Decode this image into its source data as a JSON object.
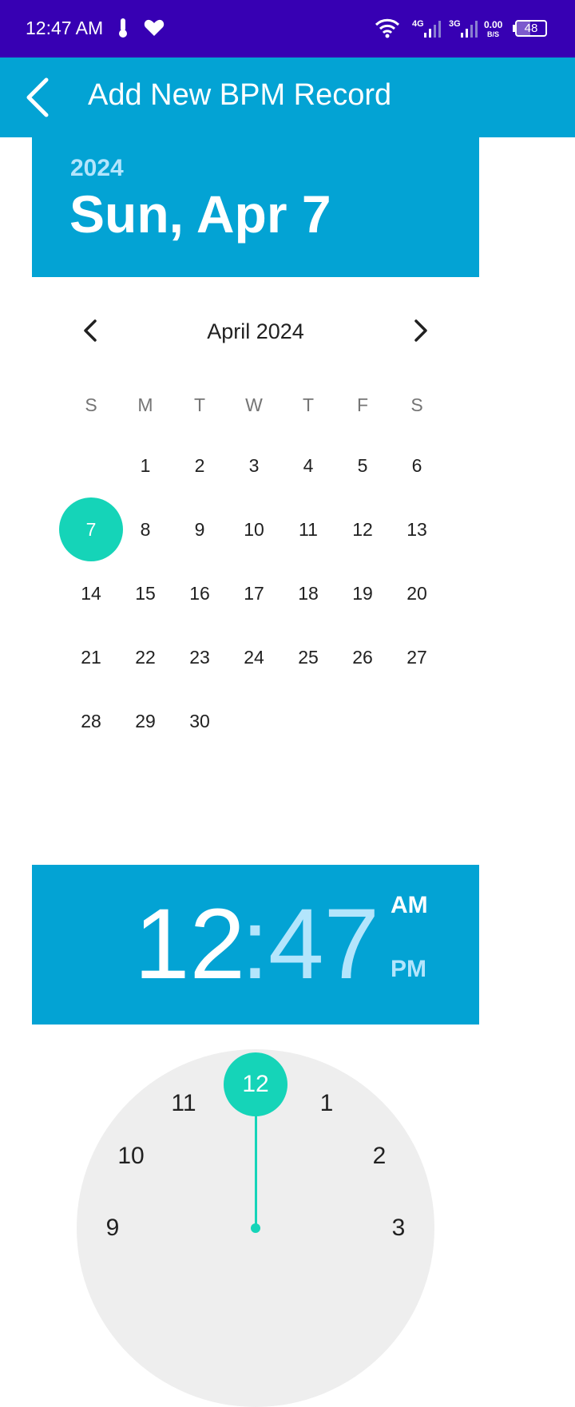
{
  "status_bar": {
    "time": "12:47 AM",
    "network_1": "4G",
    "network_2": "3G",
    "speed_value": "0.00",
    "speed_unit": "B/S",
    "battery": "48",
    "battery_level_percent": 48
  },
  "app_bar": {
    "title": "Add New BPM Record"
  },
  "date_picker": {
    "year": "2024",
    "selected_date": "Sun, Apr 7",
    "month_label": "April 2024",
    "weekdays": [
      "S",
      "M",
      "T",
      "W",
      "T",
      "F",
      "S"
    ],
    "weeks": [
      [
        "",
        "1",
        "2",
        "3",
        "4",
        "5",
        "6"
      ],
      [
        "7",
        "8",
        "9",
        "10",
        "11",
        "12",
        "13"
      ],
      [
        "14",
        "15",
        "16",
        "17",
        "18",
        "19",
        "20"
      ],
      [
        "21",
        "22",
        "23",
        "24",
        "25",
        "26",
        "27"
      ],
      [
        "28",
        "29",
        "30",
        "",
        "",
        "",
        ""
      ]
    ],
    "selected_day": "7"
  },
  "time_picker": {
    "hour": "12",
    "separator": ":",
    "minute": "47",
    "am_label": "AM",
    "pm_label": "PM",
    "selected_period": "AM",
    "clock_numbers": {
      "n12": "12",
      "n1": "1",
      "n2": "2",
      "n3": "3",
      "n9": "9",
      "n10": "10",
      "n11": "11"
    }
  },
  "colors": {
    "status_bar": "#3700b3",
    "primary": "#03a3d4",
    "accent": "#15d4b8",
    "secondary_text_on_primary": "#b3e5fc"
  }
}
